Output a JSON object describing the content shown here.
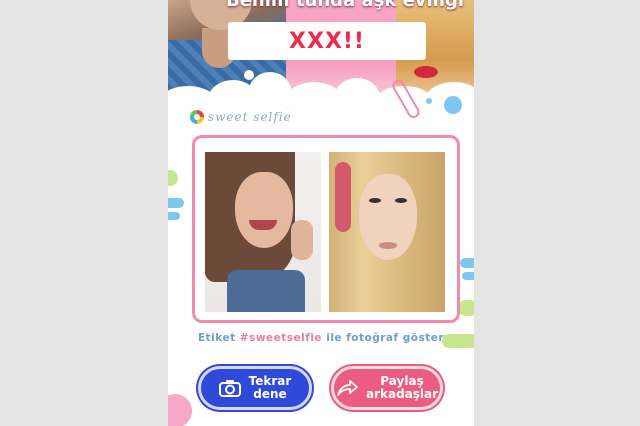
{
  "banner": {
    "title": "Benim tünda aşk evlilgi",
    "result": "XXX!!"
  },
  "logo": {
    "text": "sweet selfie"
  },
  "photos": {
    "left_alt": "smiling brunette selfie",
    "right_alt": "blonde portrait"
  },
  "tagline": {
    "prefix": "Etiket ",
    "hashtag": "#sweetselfie",
    "suffix": " ile fotoğraf göster"
  },
  "buttons": {
    "retry_label": "Tekrar\ndene",
    "share_label": "Paylaş\narkadaşlar",
    "retry_icon": "camera-icon",
    "share_icon": "share-arrow-icon"
  },
  "colors": {
    "accent_pink": "#ea5d80",
    "accent_blue": "#2f49d8",
    "frame": "#f28aab",
    "result_text": "#ee2a4e"
  }
}
